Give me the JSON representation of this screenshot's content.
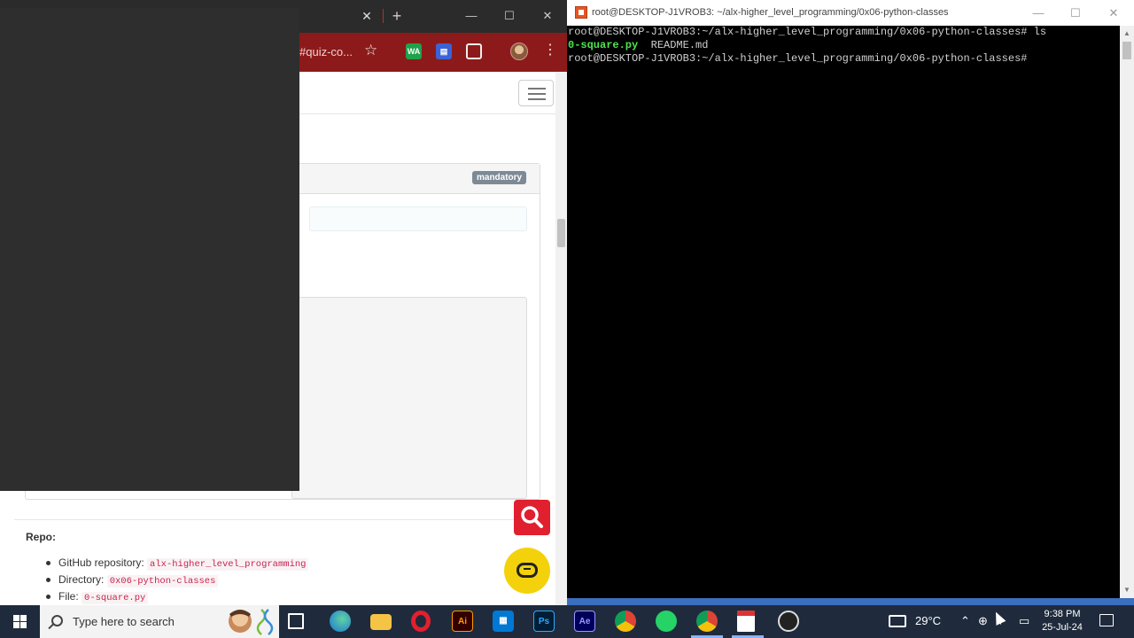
{
  "browser": {
    "url_fragment": "#quiz-co...",
    "extensions": [
      "WA",
      "",
      ""
    ],
    "page": {
      "mandatory_badge": "mandatory",
      "repo_title": "Repo:",
      "repo_items": [
        {
          "label": "GitHub repository:",
          "value": "alx-higher_level_programming"
        },
        {
          "label": "Directory:",
          "value": "0x06-python-classes"
        },
        {
          "label": "File:",
          "value": "0-square.py"
        }
      ]
    }
  },
  "terminal": {
    "title": "root@DESKTOP-J1VROB3: ~/alx-higher_level_programming/0x06-python-classes",
    "lines": {
      "line1": "root@DESKTOP-J1VROB3:~/alx-higher_level_programming/0x06-python-classes# ls",
      "line2_file1": "0-square.py",
      "line2_file2": "  README.md",
      "line3": "root@DESKTOP-J1VROB3:~/alx-higher_level_programming/0x06-python-classes#"
    }
  },
  "taskbar": {
    "search_placeholder": "Type here to search",
    "temperature": "29°C",
    "time": "9:38 PM",
    "date": "25-Jul-24",
    "apps": [
      "task-view",
      "edge",
      "file-explorer",
      "opera",
      "illustrator",
      "store",
      "photoshop",
      "after-effects",
      "chrome",
      "whatsapp",
      "chrome-profile",
      "pdf-viewer",
      "obs"
    ]
  },
  "colors": {
    "browser_toolbar": "#8d1a1a",
    "terminal_bg": "#000000",
    "terminal_green": "#4ee44e",
    "taskbar": "#1f2b3c",
    "search_fab": "#e0202e",
    "chat_fab": "#f3d20c"
  }
}
